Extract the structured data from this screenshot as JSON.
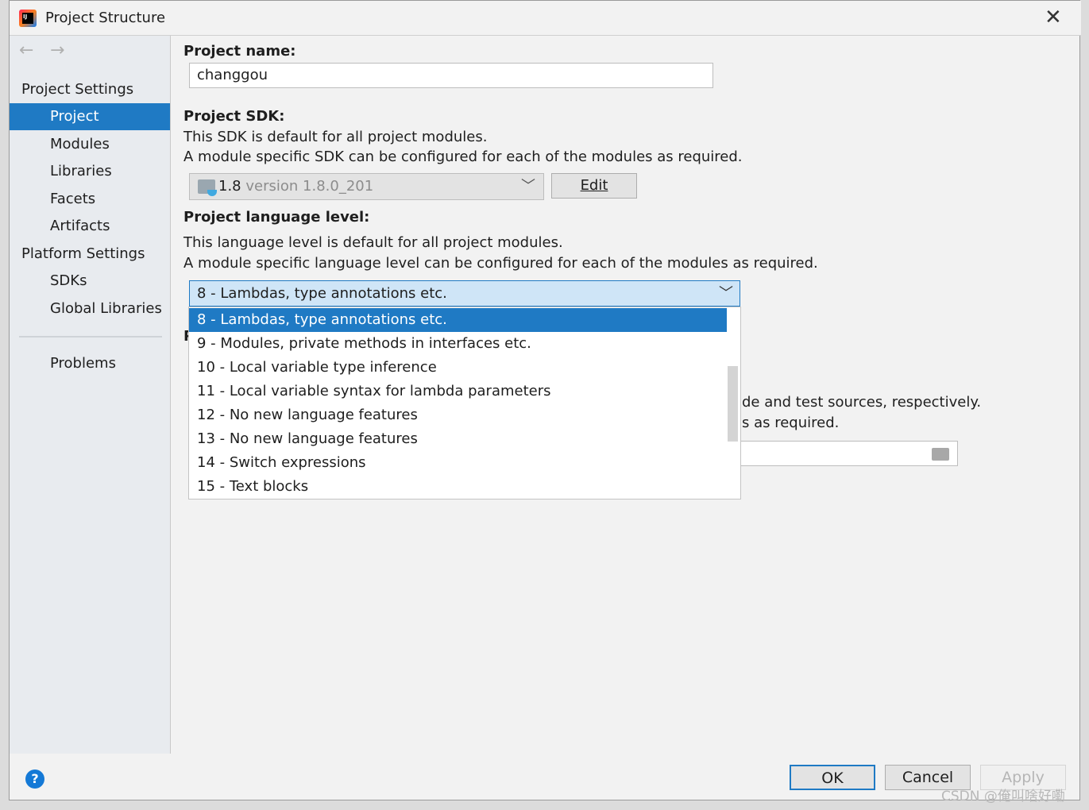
{
  "window": {
    "title": "Project Structure",
    "close_icon": "close-icon",
    "app_icon": "intellij-icon"
  },
  "sidebar": {
    "nav": {
      "back": "back-arrow-icon",
      "forward": "forward-arrow-icon"
    },
    "project_settings_header": "Project Settings",
    "project_items": [
      {
        "label": "Project",
        "selected": true
      },
      {
        "label": "Modules"
      },
      {
        "label": "Libraries"
      },
      {
        "label": "Facets"
      },
      {
        "label": "Artifacts"
      }
    ],
    "platform_settings_header": "Platform Settings",
    "platform_items": [
      {
        "label": "SDKs"
      },
      {
        "label": "Global Libraries"
      }
    ],
    "problems": "Problems"
  },
  "main": {
    "project_name_label": "Project name:",
    "project_name_value": "changgou",
    "sdk_label": "Project SDK:",
    "sdk_desc1": "This SDK is default for all project modules.",
    "sdk_desc2": "A module specific SDK can be configured for each of the modules as required.",
    "sdk_value_main": "1.8",
    "sdk_value_version": "version 1.8.0_201",
    "edit_button": "Edit",
    "lang_label": "Project language level:",
    "lang_desc1": "This language level is default for all project modules.",
    "lang_desc2": "A module specific language level can be configured for each of the modules as required.",
    "lang_selected": "8 - Lambdas, type annotations etc.",
    "lang_options": [
      "8 - Lambdas, type annotations etc.",
      "9 - Modules, private methods in interfaces etc.",
      "10 - Local variable type inference",
      "11 - Local variable syntax for lambda parameters",
      "12 - No new language features",
      "13 - No new language features",
      "14 - Switch expressions",
      "15 - Text blocks"
    ],
    "hidden_fragment1": "de and test sources, respectively.",
    "hidden_fragment2": "s as required."
  },
  "footer": {
    "ok": "OK",
    "cancel": "Cancel",
    "apply": "Apply",
    "help_icon": "help-icon"
  },
  "watermark": "CSDN @俺叫啥好嘞",
  "colors": {
    "accent": "#1f7ac4",
    "selected_field": "#cfe5f7"
  }
}
